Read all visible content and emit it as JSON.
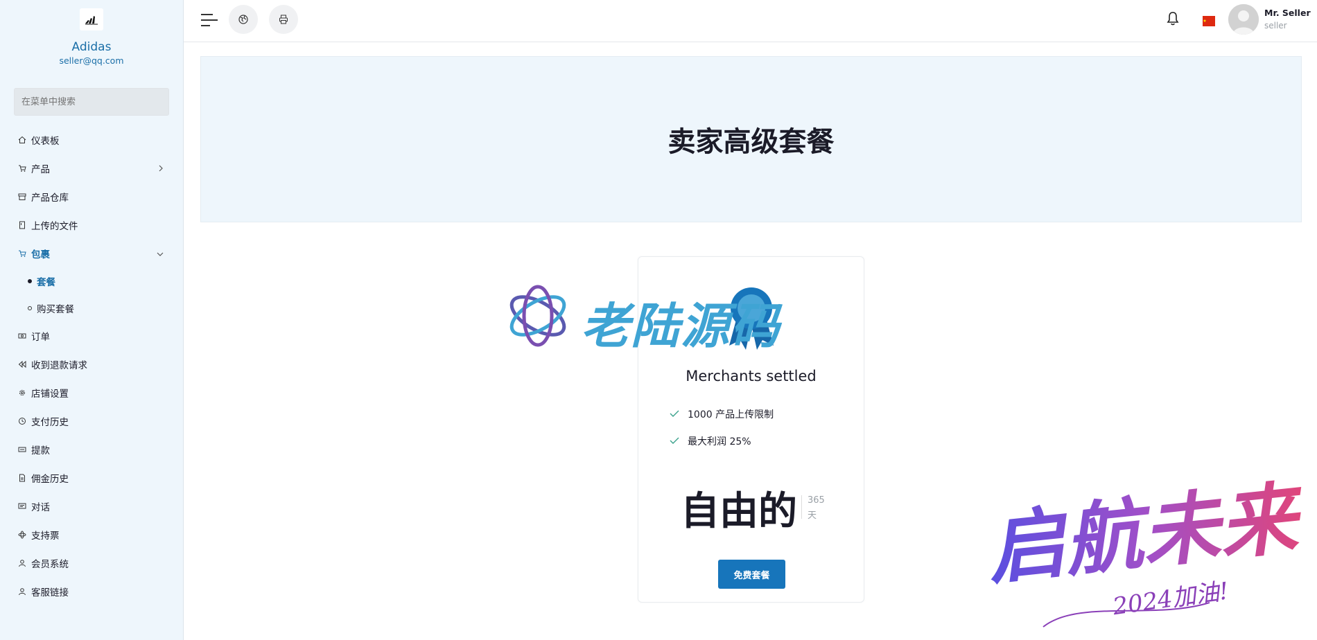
{
  "sidebar": {
    "brand_name": "Adidas",
    "brand_email": "seller@qq.com",
    "search_placeholder": "在菜单中搜索",
    "items": [
      {
        "label": "仪表板",
        "icon": "home-icon"
      },
      {
        "label": "产品",
        "icon": "cart-icon",
        "has_arrow": true
      },
      {
        "label": "产品仓库",
        "icon": "archive-icon"
      },
      {
        "label": "上传的文件",
        "icon": "file-icon"
      },
      {
        "label": "包裹",
        "icon": "cart-icon",
        "active": true,
        "expanded": true
      },
      {
        "label": "订单",
        "icon": "money-icon"
      },
      {
        "label": "收到退款请求",
        "icon": "rewind-icon"
      },
      {
        "label": "店铺设置",
        "icon": "cog-icon"
      },
      {
        "label": "支付历史",
        "icon": "history-icon"
      },
      {
        "label": "提款",
        "icon": "cash-icon"
      },
      {
        "label": "佣金历史",
        "icon": "document-icon"
      },
      {
        "label": "对话",
        "icon": "chat-icon"
      },
      {
        "label": "支持票",
        "icon": "atom-icon"
      },
      {
        "label": "会员系统",
        "icon": "user-icon"
      },
      {
        "label": "客服链接",
        "icon": "user-icon"
      }
    ],
    "sub_items": [
      {
        "label": "套餐",
        "active": true
      },
      {
        "label": "购买套餐",
        "active": false
      }
    ]
  },
  "topbar": {
    "user_name": "Mr. Seller",
    "user_role": "seller",
    "flag_color": "#de2910"
  },
  "page": {
    "title": "卖家高级套餐"
  },
  "package": {
    "name": "Merchants settled",
    "features": [
      "1000 产品上传限制",
      "最大利润 25%"
    ],
    "price": "自由的",
    "duration_value": "365",
    "duration_unit": "天",
    "button_label": "免费套餐"
  },
  "watermarks": {
    "top_text": "老陆源码",
    "bottom_text": "启航未来",
    "bottom_sub": "2024加油!"
  },
  "colors": {
    "accent": "#1775bb",
    "sidebar_bg": "#eef6fc",
    "hero_bg": "#eef6fc"
  }
}
